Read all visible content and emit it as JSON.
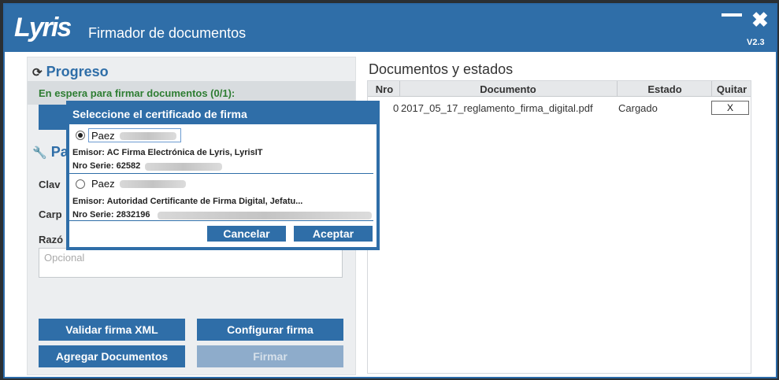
{
  "app": {
    "logo": "Lyris",
    "title": "Firmador de documentos",
    "version": "V2.3"
  },
  "left": {
    "progress_title": "Progreso",
    "waiting_text": "En espera para firmar documentos (0/1):",
    "params_title": "Pa",
    "fields": {
      "key": "Clav",
      "folder": "Carp",
      "reason": "Razó"
    },
    "reason_placeholder": "Opcional",
    "buttons": {
      "validate_xml": "Validar firma XML",
      "configure": "Configurar firma",
      "add_docs": "Agregar Documentos",
      "sign": "Firmar"
    }
  },
  "right": {
    "title": "Documentos y estados",
    "columns": {
      "nro": "Nro",
      "doc": "Documento",
      "state": "Estado",
      "remove": "Quitar"
    },
    "rows": [
      {
        "nro": "0",
        "doc": "2017_05_17_reglamento_firma_digital.pdf",
        "state": "Cargado",
        "remove": "X"
      }
    ]
  },
  "dialog": {
    "title": "Seleccione el certificado de firma",
    "certs": [
      {
        "name": "Paez",
        "issuer": "Emisor: AC Firma Electrónica de Lyris, LyrisIT",
        "serial": "Nro Serie: 62582",
        "selected": true
      },
      {
        "name": "Paez",
        "issuer": "Emisor: Autoridad Certificante de Firma Digital, Jefatu...",
        "serial": "Nro Serie: 2832196",
        "selected": false
      }
    ],
    "cancel": "Cancelar",
    "accept": "Aceptar"
  }
}
